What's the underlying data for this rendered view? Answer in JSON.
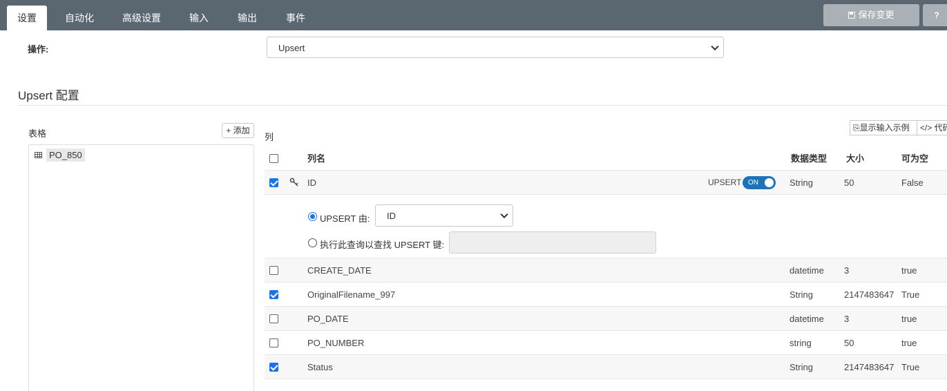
{
  "tabs": [
    "设置",
    "自动化",
    "高级设置",
    "输入",
    "输出",
    "事件"
  ],
  "header": {
    "save_label": "保存变更",
    "help_label": "?"
  },
  "operation": {
    "label": "操作:",
    "value": "Upsert"
  },
  "section": {
    "title": "Upsert 配置"
  },
  "tables": {
    "label": "表格",
    "add_label": "+ 添加",
    "items": [
      "PO_850"
    ]
  },
  "columns": {
    "label": "列",
    "show_sample_label": "显示输入示例",
    "code_label": "</> 代码",
    "headers": {
      "name": "列名",
      "type": "数据类型",
      "size": "大小",
      "nullable": "可为空"
    },
    "upsert_label": "UPSERT",
    "toggle_label": "ON",
    "upsert_by_label": "UPSERT 由:",
    "upsert_by_value": "ID",
    "query_label": "执行此查询以查找 UPSERT 键:",
    "rows": [
      {
        "name": "ID",
        "type": "String",
        "size": "50",
        "nullable": "False",
        "checked": true
      },
      {
        "name": "CREATE_DATE",
        "type": "datetime",
        "size": "3",
        "nullable": "true",
        "checked": false
      },
      {
        "name": "OriginalFilename_997",
        "type": "String",
        "size": "2147483647",
        "nullable": "True",
        "checked": true
      },
      {
        "name": "PO_DATE",
        "type": "datetime",
        "size": "3",
        "nullable": "true",
        "checked": false
      },
      {
        "name": "PO_NUMBER",
        "type": "string",
        "size": "50",
        "nullable": "true",
        "checked": false
      },
      {
        "name": "Status",
        "type": "String",
        "size": "2147483647",
        "nullable": "True",
        "checked": true
      }
    ]
  },
  "colors": {
    "topbar": "#5b6770",
    "accent": "#1a73e8",
    "toggle": "#1e73b8"
  }
}
